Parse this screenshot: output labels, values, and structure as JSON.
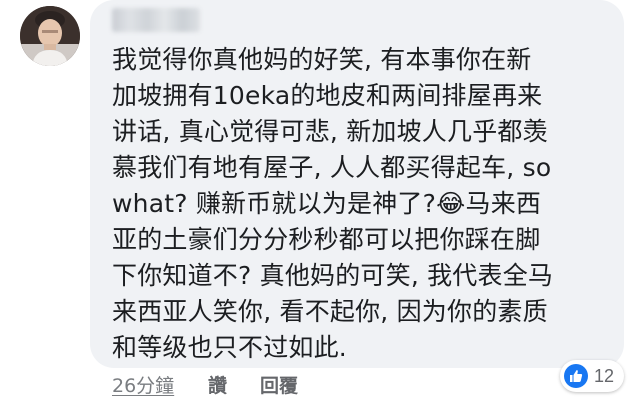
{
  "comment": {
    "lines": [
      "我觉得你真他妈的好笑, 有本事你在新",
      "加坡拥有10eka的地皮和两间排屋再来",
      "讲话, 真心觉得可悲, 新加坡人几乎都羡",
      "慕我们有地有屋子, 人人都买得起车, so",
      "what? 赚新币就以为是神了?😂马来西",
      "亚的土豪们分分秒秒都可以把你踩在脚",
      "下你知道不? 真他妈的可笑, 我代表全马",
      "来西亚人笑你, 看不起你, 因为你的素质",
      "和等级也只不过如此."
    ]
  },
  "actions": {
    "time": "26分鐘",
    "like": "讚",
    "reply": "回覆"
  },
  "reaction": {
    "icon": "like-icon",
    "count": "12",
    "color": "#1877f2"
  },
  "colors": {
    "bubble": "#f0f2f5",
    "text": "#1c1e21",
    "meta": "#65676b"
  }
}
